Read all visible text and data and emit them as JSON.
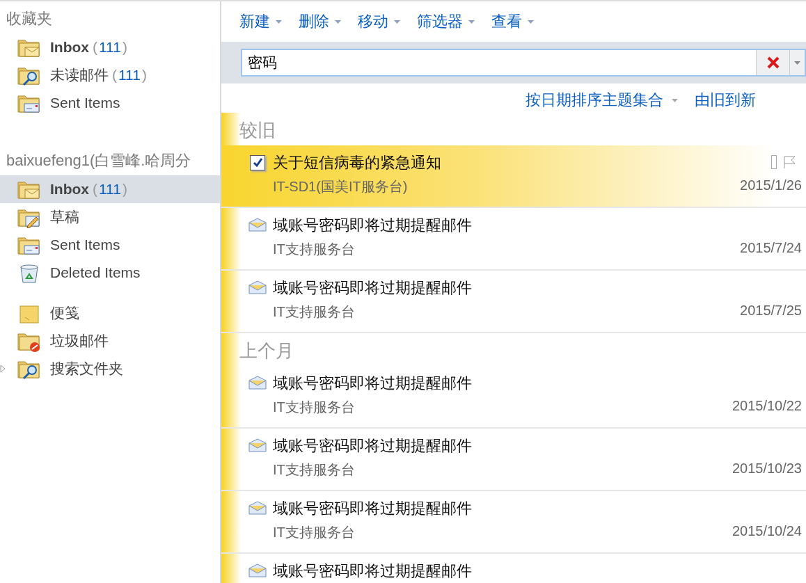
{
  "favorites": {
    "title": "收藏夹",
    "items": [
      {
        "label": "Inbox",
        "count": "(111)",
        "bold": true,
        "selected": false,
        "kind": "inbox",
        "expandable": false
      },
      {
        "label": "未读邮件",
        "count": "(111)",
        "bold": false,
        "selected": false,
        "kind": "search",
        "expandable": false
      },
      {
        "label": "Sent Items",
        "bold": false,
        "selected": false,
        "kind": "sent",
        "expandable": false
      }
    ]
  },
  "account": {
    "title": "baixuefeng1(白雪峰.哈周分",
    "folders": [
      {
        "label": "Inbox",
        "count": "(111)",
        "bold": true,
        "selected": true,
        "kind": "inbox",
        "expandable": false
      },
      {
        "label": "草稿",
        "bold": false,
        "selected": false,
        "kind": "drafts",
        "expandable": false
      },
      {
        "label": "Sent Items",
        "bold": false,
        "selected": false,
        "kind": "sent",
        "expandable": false
      },
      {
        "label": "Deleted Items",
        "bold": false,
        "selected": false,
        "kind": "deleted",
        "expandable": false
      }
    ],
    "more_folders": [
      {
        "label": "便笺",
        "bold": false,
        "selected": false,
        "kind": "notes",
        "expandable": false
      },
      {
        "label": "垃圾邮件",
        "bold": false,
        "selected": false,
        "kind": "junk",
        "expandable": false
      },
      {
        "label": "搜索文件夹",
        "bold": false,
        "selected": false,
        "kind": "search",
        "expandable": true
      }
    ]
  },
  "toolbar": [
    {
      "label": "新建"
    },
    {
      "label": "删除"
    },
    {
      "label": "移动"
    },
    {
      "label": "筛选器"
    },
    {
      "label": "查看"
    }
  ],
  "search": {
    "value": "密码"
  },
  "sort": {
    "label": "按日期排序主题集合",
    "order": "由旧到新"
  },
  "groups": [
    {
      "title": "较旧",
      "messages": [
        {
          "selected": true,
          "subject": "关于短信病毒的紧急通知",
          "sender": "IT-SD1(国美IT服务台)",
          "date": "2015/1/26"
        },
        {
          "selected": false,
          "subject": "域账号密码即将过期提醒邮件",
          "sender": "IT支持服务台",
          "date": "2015/7/24"
        },
        {
          "selected": false,
          "subject": "域账号密码即将过期提醒邮件",
          "sender": "IT支持服务台",
          "date": "2015/7/25"
        }
      ]
    },
    {
      "title": "上个月",
      "messages": [
        {
          "selected": false,
          "subject": "域账号密码即将过期提醒邮件",
          "sender": "IT支持服务台",
          "date": "2015/10/22"
        },
        {
          "selected": false,
          "subject": "域账号密码即将过期提醒邮件",
          "sender": "IT支持服务台",
          "date": "2015/10/23"
        },
        {
          "selected": false,
          "subject": "域账号密码即将过期提醒邮件",
          "sender": "IT支持服务台",
          "date": "2015/10/24"
        },
        {
          "selected": false,
          "subject": "域账号密码即将过期提醒邮件"
        }
      ]
    }
  ]
}
